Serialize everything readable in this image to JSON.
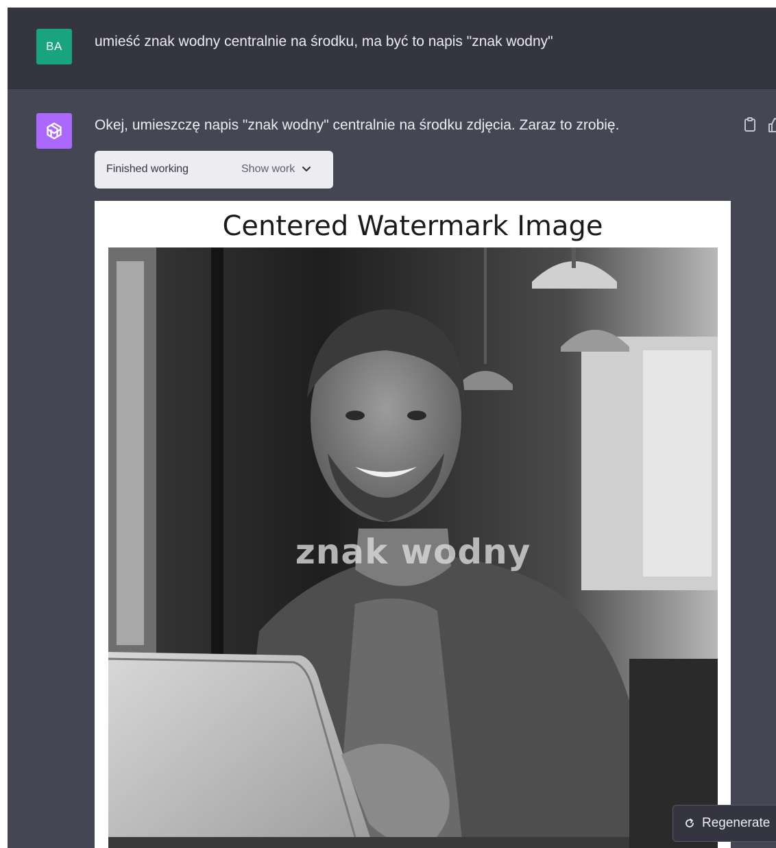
{
  "user_message": {
    "avatar_initials": "BA",
    "avatar_color": "#19a37f",
    "text": "umieść znak wodny centralnie na środku, ma być to napis \"znak wodny\""
  },
  "assistant_message": {
    "avatar_icon": "openai-logo-icon",
    "avatar_color": "#ab68ff",
    "text": "Okej, umieszczę napis \"znak wodny\" centralnie na środku zdjęcia. Zaraz to zrobię.",
    "work_status": "Finished working",
    "show_work_label": "Show work"
  },
  "figure": {
    "title": "Centered Watermark Image",
    "watermark_text": "znak wodny",
    "photo_description_icon": "portrait-photo"
  },
  "actions": {
    "copy_icon": "clipboard-icon",
    "thumb_icon": "thumbs-up-icon",
    "regenerate_label": "Regenerate",
    "regenerate_icon": "refresh-icon"
  },
  "colors": {
    "user_bg": "#343541",
    "assistant_bg": "#444654",
    "text": "#ececf1"
  }
}
